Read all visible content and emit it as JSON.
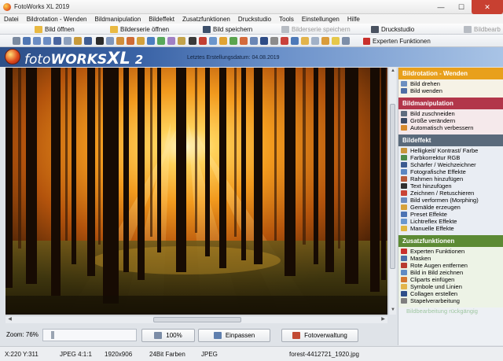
{
  "window": {
    "title": "FotoWorks XL 2019",
    "minimize": "—",
    "maximize": "☐",
    "close": "✕"
  },
  "menu": [
    "Datei",
    "Bildrotation - Wenden",
    "Bildmanipulation",
    "Bildeffekt",
    "Zusatzfunktionen",
    "Druckstudio",
    "Tools",
    "Einstellungen",
    "Hilfe"
  ],
  "toolbar": {
    "open_image": "Bild öffnen",
    "open_series": "Bilderserie öffnen",
    "save_image": "Bild speichern",
    "save_series": "Bilderserie speichern",
    "print_studio": "Druckstudio",
    "right_cut": "Bildbearb",
    "expert": "Experten Funktionen"
  },
  "banner": {
    "logo_foto": "foto",
    "logo_works": "WORKS",
    "logo_xl": "XL",
    "logo_num": "2",
    "updated": "Letztes Erstellungsdatum: 04.08.2019"
  },
  "bottom": {
    "zoom": "Zoom: 76%",
    "btn_100": "100%",
    "btn_fit": "Einpassen",
    "btn_manage": "Fotoverwaltung"
  },
  "sidebar": {
    "sections": [
      {
        "title": "Bildrotation - Wenden",
        "color": "#e8a01c",
        "bg": "#f6f2e6",
        "items": [
          "Bild drehen",
          "Bild wenden"
        ]
      },
      {
        "title": "Bildmanipulation",
        "color": "#b2364a",
        "bg": "#f5e9eb",
        "items": [
          "Bild zuschneiden",
          "Größe verändern",
          "Automatisch verbessern"
        ]
      },
      {
        "title": "Bildeffekt",
        "color": "#5a6a7b",
        "bg": "#e9edf3",
        "items": [
          "Helligkeit/ Kontrast/ Farbe",
          "Farbkorrektur RGB",
          "Schärfer / Weichzeichner",
          "Fotografische Effekte",
          "Rahmen hinzufügen",
          "Text hinzufügen",
          "Zeichnen / Retuschieren",
          "Bild verformen (Morphing)",
          "Gemälde erzeugen",
          "Preset Effekte",
          "Lichtreflex Effekte",
          "Manuelle Effekte"
        ]
      },
      {
        "title": "Zusatzfunktionen",
        "color": "#5c8a34",
        "bg": "#edf3e6",
        "items": [
          "Experten Funktionen",
          "Masken",
          "Rote Augen entfernen",
          "Bild in Bild zeichnen",
          "Cliparts einfügen",
          "Symbole und Linien",
          "Collagen erstellen",
          "Stapelverarbeitung"
        ]
      }
    ],
    "undo": "Bildbearbeitung rückgängig"
  },
  "status": {
    "coords": "X:220 Y:311",
    "format": "JPEG  4:1:1",
    "size": "1920x906",
    "colors": "24Bit Farben",
    "type": "JPEG",
    "file": "forest-4412721_1920.jpg"
  }
}
